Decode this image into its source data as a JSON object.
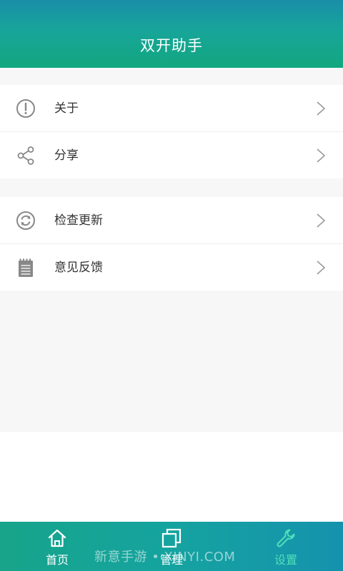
{
  "header": {
    "title": "双开助手"
  },
  "settings": {
    "groups": [
      {
        "items": [
          {
            "label": "关于",
            "icon": "info-circle-icon"
          },
          {
            "label": "分享",
            "icon": "share-icon"
          }
        ]
      },
      {
        "items": [
          {
            "label": "检查更新",
            "icon": "refresh-icon"
          },
          {
            "label": "意见反馈",
            "icon": "notepad-icon"
          }
        ]
      }
    ]
  },
  "nav": {
    "home": "首页",
    "manage": "管理",
    "settings": "设置",
    "active": "settings"
  },
  "watermark": "新意手游 • XINYI.COM",
  "colors": {
    "accent_active": "#4fe0b8",
    "header_top": "#1a8ea8",
    "header_bottom": "#12a77e",
    "icon_gray": "#888888"
  }
}
